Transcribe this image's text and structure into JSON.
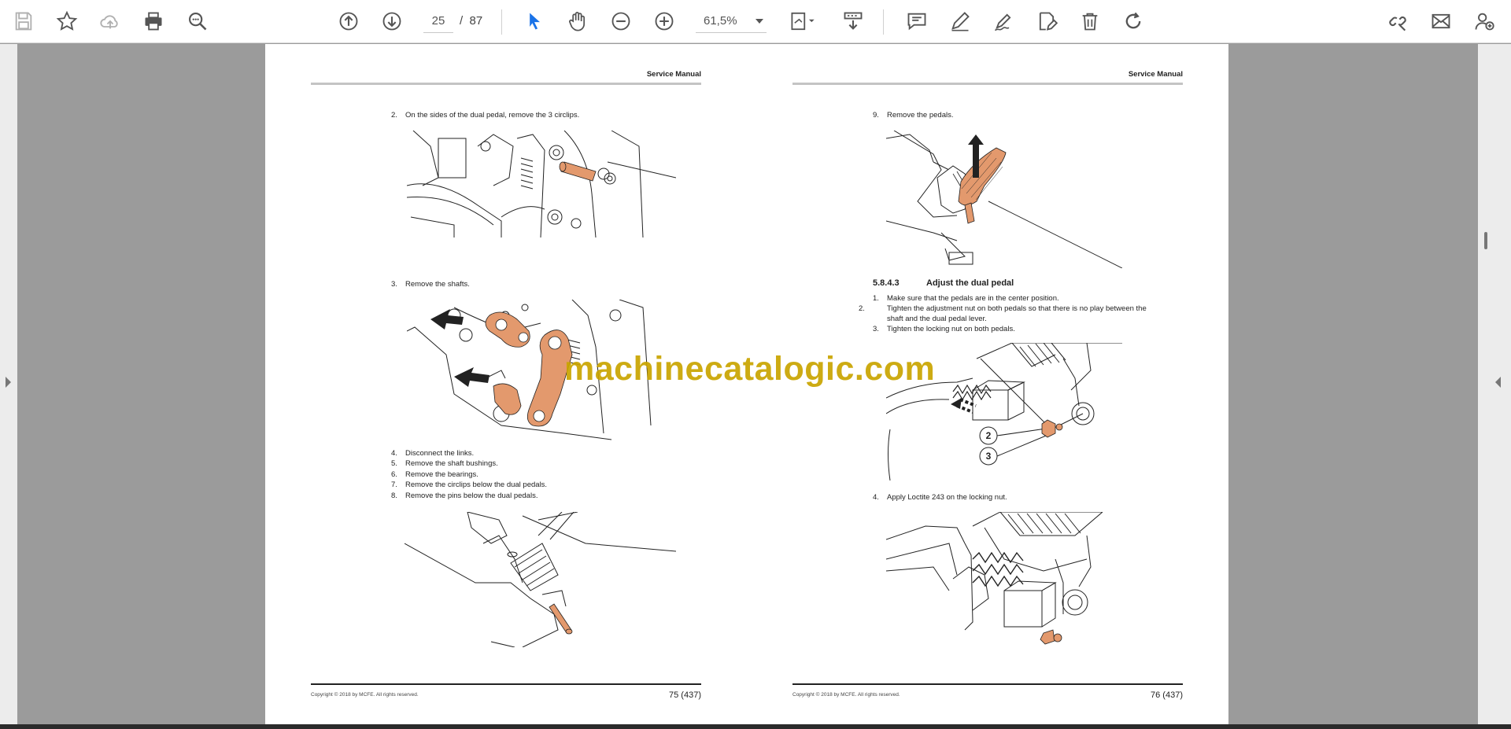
{
  "toolbar": {
    "page_current": "25",
    "page_sep": "/",
    "page_total": "87",
    "zoom": "61,5%"
  },
  "page_left": {
    "header": "Service Manual",
    "steps": [
      {
        "n": "2.",
        "text": "On the sides of the dual pedal, remove the 3 circlips."
      },
      {
        "n": "3.",
        "text": "Remove the shafts."
      },
      {
        "n": "4.",
        "text": "Disconnect the links."
      },
      {
        "n": "5.",
        "text": "Remove the shaft bushings."
      },
      {
        "n": "6.",
        "text": "Remove the bearings."
      },
      {
        "n": "7.",
        "text": "Remove the circlips below the dual pedals."
      },
      {
        "n": "8.",
        "text": "Remove the pins below the dual pedals."
      }
    ],
    "copyright": "Copyright © 2018 by MCFE. All rights reserved.",
    "page_number": "75 (437)"
  },
  "page_right": {
    "header": "Service Manual",
    "step9": {
      "n": "9.",
      "text": "Remove the pedals."
    },
    "section": {
      "num": "5.8.4.3",
      "title": "Adjust the dual pedal"
    },
    "steps": [
      {
        "n": "1.",
        "text": "Make sure that the pedals are in the center position."
      },
      {
        "n": "2.",
        "text": "Tighten the adjustment nut on both pedals so that there is no play between the shaft and the dual pedal lever."
      },
      {
        "n": "3.",
        "text": "Tighten the locking nut on both pedals."
      }
    ],
    "callouts": [
      "2",
      "3"
    ],
    "step4": {
      "n": "4.",
      "text": "Apply Loctite 243 on the locking nut."
    },
    "copyright": "Copyright © 2018 by MCFE. All rights reserved.",
    "page_number": "76 (437)"
  },
  "watermark": "machinecatalogic.com",
  "colors": {
    "accent_blue": "#1a73e8",
    "highlight_orange": "#e3996d",
    "watermark": "#c9a400",
    "viewer_bg": "#9b9b9b"
  },
  "icons": [
    "save-icon",
    "star-icon",
    "cloud-upload-icon",
    "print-icon",
    "zoom-search-icon",
    "page-up-icon",
    "page-down-icon",
    "select-cursor-icon",
    "hand-icon",
    "zoom-out-icon",
    "zoom-in-icon",
    "page-fit-icon",
    "scroll-mode-icon",
    "comment-icon",
    "pen-icon",
    "sign-icon",
    "edit-pdf-icon",
    "trash-icon",
    "rotate-icon",
    "link-icon",
    "mail-icon",
    "add-user-icon"
  ]
}
